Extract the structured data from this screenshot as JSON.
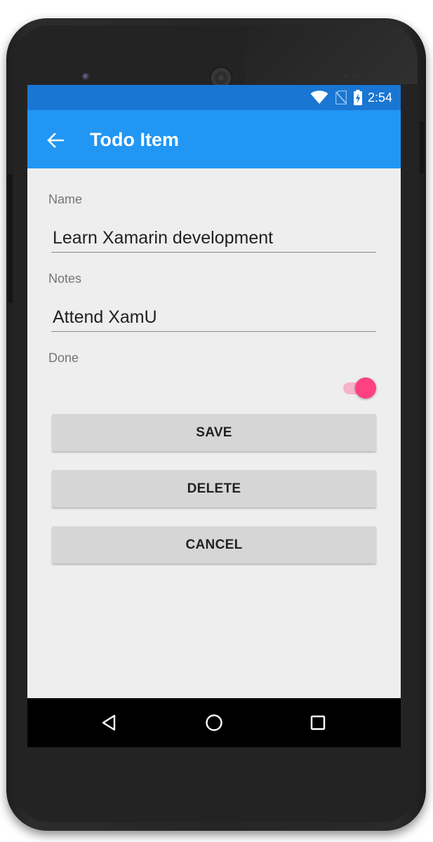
{
  "status_bar": {
    "time": "2:54",
    "icons": [
      "wifi-icon",
      "no-sim-icon",
      "battery-charging-icon"
    ],
    "background": "#1976d2"
  },
  "app_bar": {
    "title": "Todo Item",
    "back_icon": "arrow-back-icon",
    "background": "#2196f3"
  },
  "form": {
    "name": {
      "label": "Name",
      "value": "Learn Xamarin development"
    },
    "notes": {
      "label": "Notes",
      "value": "Attend XamU"
    },
    "done": {
      "label": "Done",
      "checked": true,
      "accent": "#ff4081"
    }
  },
  "buttons": {
    "save_label": "SAVE",
    "delete_label": "DELETE",
    "cancel_label": "CANCEL"
  },
  "nav_bar": {
    "icons": [
      "back-triangle-icon",
      "home-circle-icon",
      "recents-square-icon"
    ]
  }
}
